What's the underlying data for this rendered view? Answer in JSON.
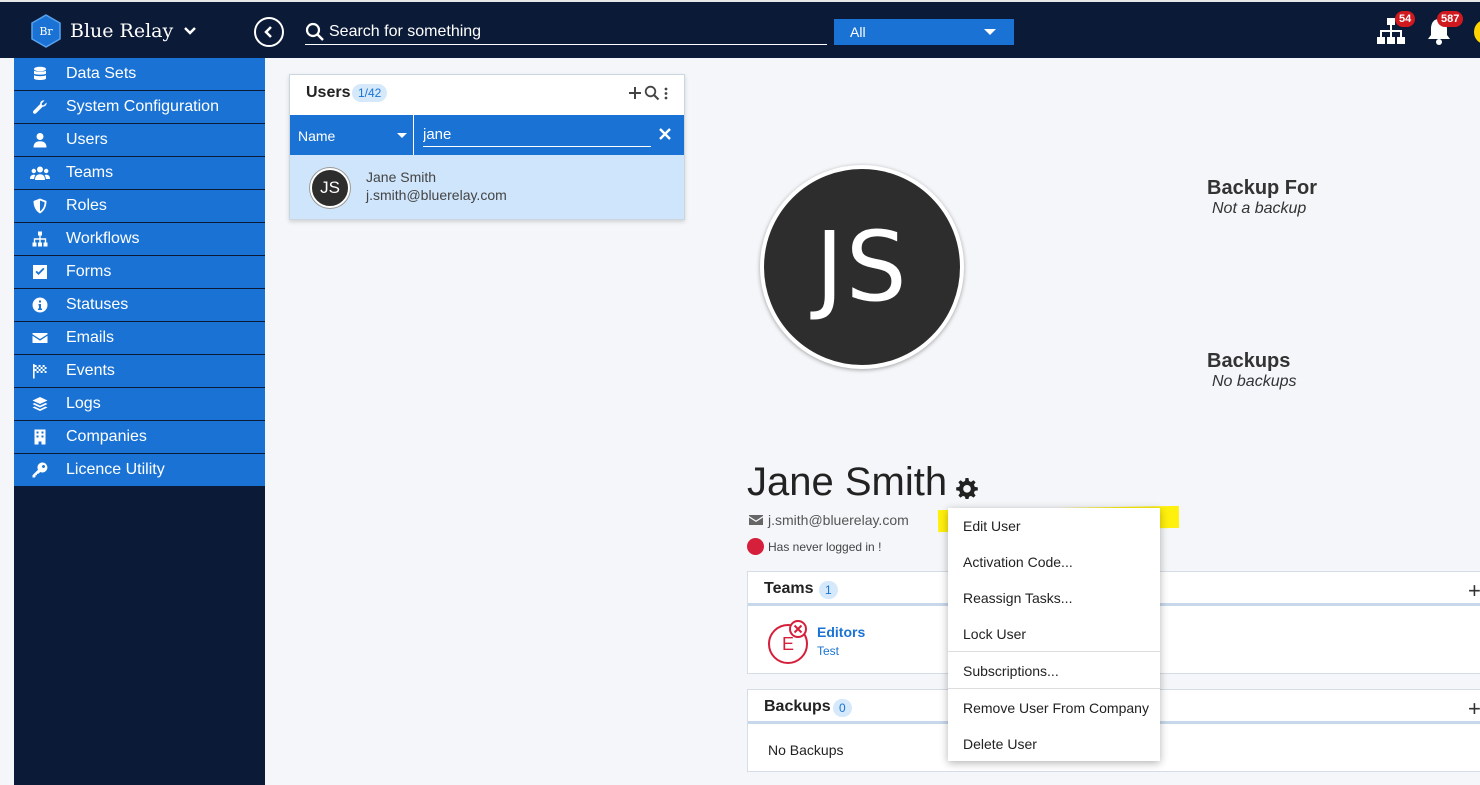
{
  "brand": {
    "name": "Blue Relay",
    "logo_text": "Br"
  },
  "search": {
    "placeholder": "Search for something",
    "scope": "All"
  },
  "notifications": {
    "org_badge": "54",
    "bell_badge": "587"
  },
  "sidebar": {
    "items": [
      {
        "label": "Data Sets",
        "icon": "database-icon"
      },
      {
        "label": "System Configuration",
        "icon": "wrench-icon"
      },
      {
        "label": "Users",
        "icon": "user-icon"
      },
      {
        "label": "Teams",
        "icon": "users-icon"
      },
      {
        "label": "Roles",
        "icon": "shield-icon"
      },
      {
        "label": "Workflows",
        "icon": "sitemap-icon"
      },
      {
        "label": "Forms",
        "icon": "checkbox-icon"
      },
      {
        "label": "Statuses",
        "icon": "info-icon"
      },
      {
        "label": "Emails",
        "icon": "envelope-icon"
      },
      {
        "label": "Events",
        "icon": "flag-checkered-icon"
      },
      {
        "label": "Logs",
        "icon": "layers-icon"
      },
      {
        "label": "Companies",
        "icon": "building-icon"
      },
      {
        "label": "Licence Utility",
        "icon": "key-icon"
      }
    ]
  },
  "users_panel": {
    "title": "Users",
    "count": "1/42",
    "filter_field": "Name",
    "filter_value": "jane",
    "results": [
      {
        "initials": "JS",
        "name": "Jane Smith",
        "email": "j.smith@bluerelay.com"
      }
    ]
  },
  "profile": {
    "initials": "JS",
    "name": "Jane Smith",
    "email": "j.smith@bluerelay.com",
    "login_status": "Has never logged in !",
    "backup_for_label": "Backup For",
    "backup_for_value": "Not a backup",
    "backups_label": "Backups",
    "backups_value": "No backups"
  },
  "teams_card": {
    "title": "Teams",
    "count": "1",
    "items": [
      {
        "initial": "E",
        "name": "Editors",
        "sub": "Test"
      }
    ]
  },
  "backups_card": {
    "title": "Backups",
    "count": "0",
    "empty": "No Backups"
  },
  "context_menu": {
    "items": [
      "Edit User",
      "Activation Code...",
      "Reassign Tasks...",
      "Lock User",
      "Subscriptions...",
      "Remove User From Company",
      "Delete User"
    ]
  },
  "colors": {
    "accent": "#1a73d4",
    "navy": "#0b1a36",
    "alert": "#d61f3b",
    "highlight": "#ffef00"
  }
}
